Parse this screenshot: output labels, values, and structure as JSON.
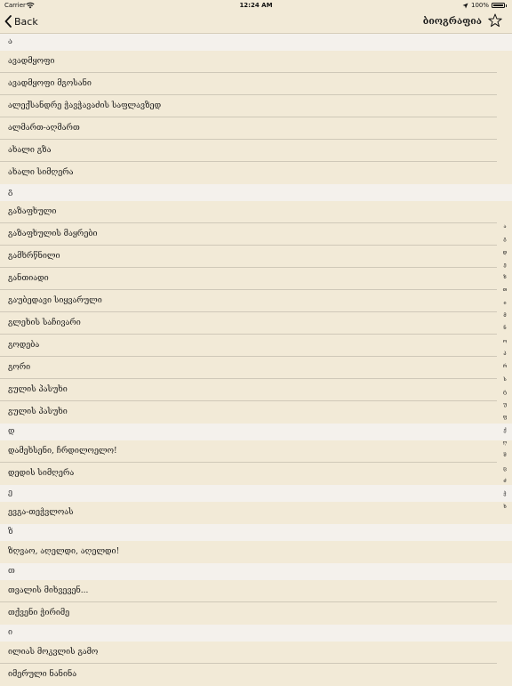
{
  "status_bar": {
    "carrier": "Carrier",
    "time": "12:24 AM",
    "battery": "100%"
  },
  "nav": {
    "back_label": "Back",
    "title": "ბიოგრაფია"
  },
  "sections": [
    {
      "header": "ა",
      "rows": [
        "ავადმყოფი",
        "ავადმყოფი მგოსანი",
        "ალექსანდრე ჭავჭავაძის საფლავზედ",
        "ალმართ-აღმართ",
        "ახალი გზა",
        "ახალი სიმღერა"
      ]
    },
    {
      "header": "გ",
      "rows": [
        "გაზაფხული",
        "გაზაფხულის მაყრები",
        "გამხრწნილი",
        "განთიადი",
        "გაუბედავი სიყვარული",
        "გლეხის საჩივარი",
        "გოდება",
        "გორი",
        "გულის პასუხი",
        "გულის პასუხი"
      ]
    },
    {
      "header": "დ",
      "rows": [
        "დამეხსენი, ჩრდილოელო!",
        "დედის სიმღერა"
      ]
    },
    {
      "header": "ე",
      "rows": [
        "ევგა-თეჭვლოას"
      ]
    },
    {
      "header": "ზ",
      "rows": [
        "ზღვაო, აღელდი, აღელდი!"
      ]
    },
    {
      "header": "თ",
      "rows": [
        "თვალის მიხვევენ...",
        "თქვენი ჭირიმე"
      ]
    },
    {
      "header": "ი",
      "rows": [
        "ილიას მოკვლის გამო",
        "იმერული ნანინა"
      ]
    }
  ],
  "index_letters": [
    "ა",
    "გ",
    "დ",
    "ე",
    "ზ",
    "თ",
    "ი",
    "მ",
    "ნ",
    "ო",
    "პ",
    "რ",
    "ს",
    "ტ",
    "უ",
    "ფ",
    "ქ",
    "ღ",
    "შ",
    "ც",
    "ძ",
    "ჭ",
    "ხ"
  ]
}
